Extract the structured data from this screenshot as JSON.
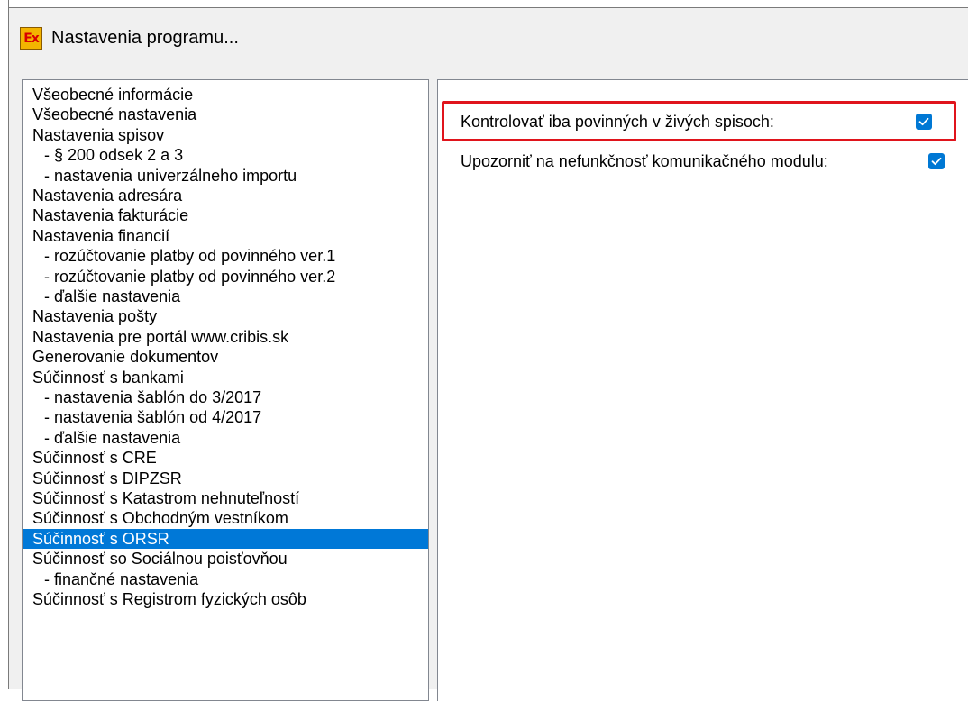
{
  "window": {
    "title": "Nastavenia programu...",
    "icon": "excel-ex-icon",
    "icon_text": "Ex"
  },
  "categories": [
    {
      "label": "Všeobecné informácie",
      "level": 0
    },
    {
      "label": "Všeobecné nastavenia",
      "level": 0
    },
    {
      "label": "Nastavenia spisov",
      "level": 0
    },
    {
      "label": "- § 200 odsek 2 a 3",
      "level": 1
    },
    {
      "label": "- nastavenia univerzálneho importu",
      "level": 1
    },
    {
      "label": "Nastavenia adresára",
      "level": 0
    },
    {
      "label": "Nastavenia fakturácie",
      "level": 0
    },
    {
      "label": "Nastavenia financií",
      "level": 0
    },
    {
      "label": "- rozúčtovanie platby od povinného ver.1",
      "level": 1
    },
    {
      "label": "- rozúčtovanie platby od povinného ver.2",
      "level": 1
    },
    {
      "label": "- ďalšie nastavenia",
      "level": 1
    },
    {
      "label": "Nastavenia pošty",
      "level": 0
    },
    {
      "label": "Nastavenia pre portál www.cribis.sk",
      "level": 0
    },
    {
      "label": "Generovanie dokumentov",
      "level": 0
    },
    {
      "label": "Súčinnosť s bankami",
      "level": 0
    },
    {
      "label": "- nastavenia šablón do 3/2017",
      "level": 1
    },
    {
      "label": "- nastavenia šablón od 4/2017",
      "level": 1
    },
    {
      "label": "- ďalšie nastavenia",
      "level": 1
    },
    {
      "label": "Súčinnosť s CRE",
      "level": 0
    },
    {
      "label": "Súčinnosť s DIPZSR",
      "level": 0
    },
    {
      "label": "Súčinnosť s Katastrom nehnuteľností",
      "level": 0
    },
    {
      "label": "Súčinnosť s Obchodným vestníkom",
      "level": 0
    },
    {
      "label": "Súčinnosť s ORSR",
      "level": 0,
      "selected": true
    },
    {
      "label": "Súčinnosť so Sociálnou poisťovňou",
      "level": 0
    },
    {
      "label": "- finančné nastavenia",
      "level": 1
    },
    {
      "label": "Súčinnosť s Registrom fyzických osôb",
      "level": 0
    }
  ],
  "options": [
    {
      "label": "Kontrolovať iba povinných v živých spisoch:",
      "checked": true,
      "highlighted": true
    },
    {
      "label": "Upozorniť na nefunkčnosť komunikačného modulu:",
      "checked": true,
      "highlighted": false
    }
  ],
  "colors": {
    "selection": "#0078d7",
    "checkbox": "#0078d4",
    "highlight": "#e0141c"
  }
}
